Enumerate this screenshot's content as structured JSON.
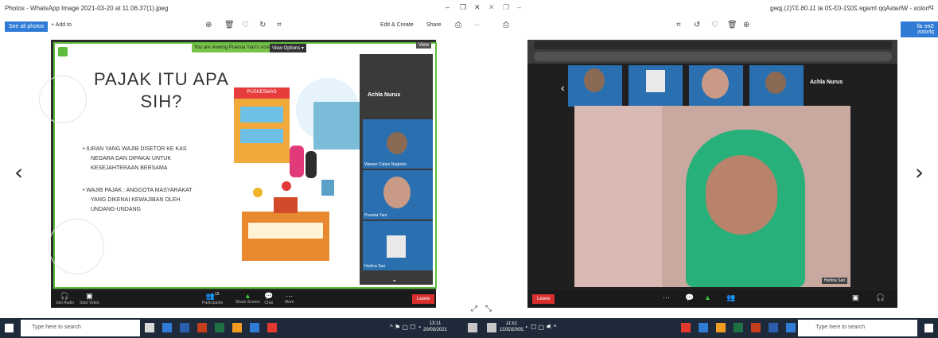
{
  "window": {
    "title": "Photos - WhatsApp Image 2021-03-20 at 11.06.37(1).jpeg",
    "title_mirrored": "Photos - WhatsApp Image 2021-03-20 at 11.06.37(1).jpeg"
  },
  "toolbar": {
    "see_all_photos": "See all photos",
    "add_to": "+ Add to",
    "edit_create": "Edit & Create",
    "share": "Share",
    "more": "···"
  },
  "meeting_left": {
    "banner": "You are viewing Praesta Yani's screen",
    "view_options": "View Options ▾",
    "view_btn": "View",
    "slide_title_line1": "PAJAK ITU APA",
    "slide_title_line2": "SIH?",
    "bullet1_l1": "•  IURAN YANG WAJIB DISETOR KE KAS",
    "bullet1_l2": "NEGARA DAN DIPAKAI UNTUK",
    "bullet1_l3": "KESEJAHTERAAN BERSAMA",
    "bullet2_l1": "•  WAJIB PAJAK : ANGGOTA MASYARAKAT",
    "bullet2_l2": "YANG DIKENAI KEWAJIBAN OLEH",
    "bullet2_l3": "UNDANG-UNDANG",
    "puskesmas": "PUSKESMAS",
    "panel_name": "Achla Nurus",
    "tile1": "Wawan Cahyo Nugroho",
    "tile2": "Praesta Yani",
    "tile3": "Herlina Sari",
    "bar": {
      "join_audio": "Join Audio",
      "start_video": "Start Video",
      "participants": "Participants",
      "share_screen": "Share Screen",
      "chat": "Chat",
      "more": "More",
      "leave": "Leave",
      "participants_count": "13"
    }
  },
  "meeting_right": {
    "panel_name": "Achla Nurus",
    "name_tag": "Herlina Sari",
    "leave": "Leave"
  },
  "taskbar": {
    "search_placeholder": "Type here to search",
    "time": "13:11",
    "date": "20/03/2021",
    "time_mirrored": "13:11",
    "date_mirrored": "20/03/2021",
    "search_mirrored": "Type here to search"
  }
}
